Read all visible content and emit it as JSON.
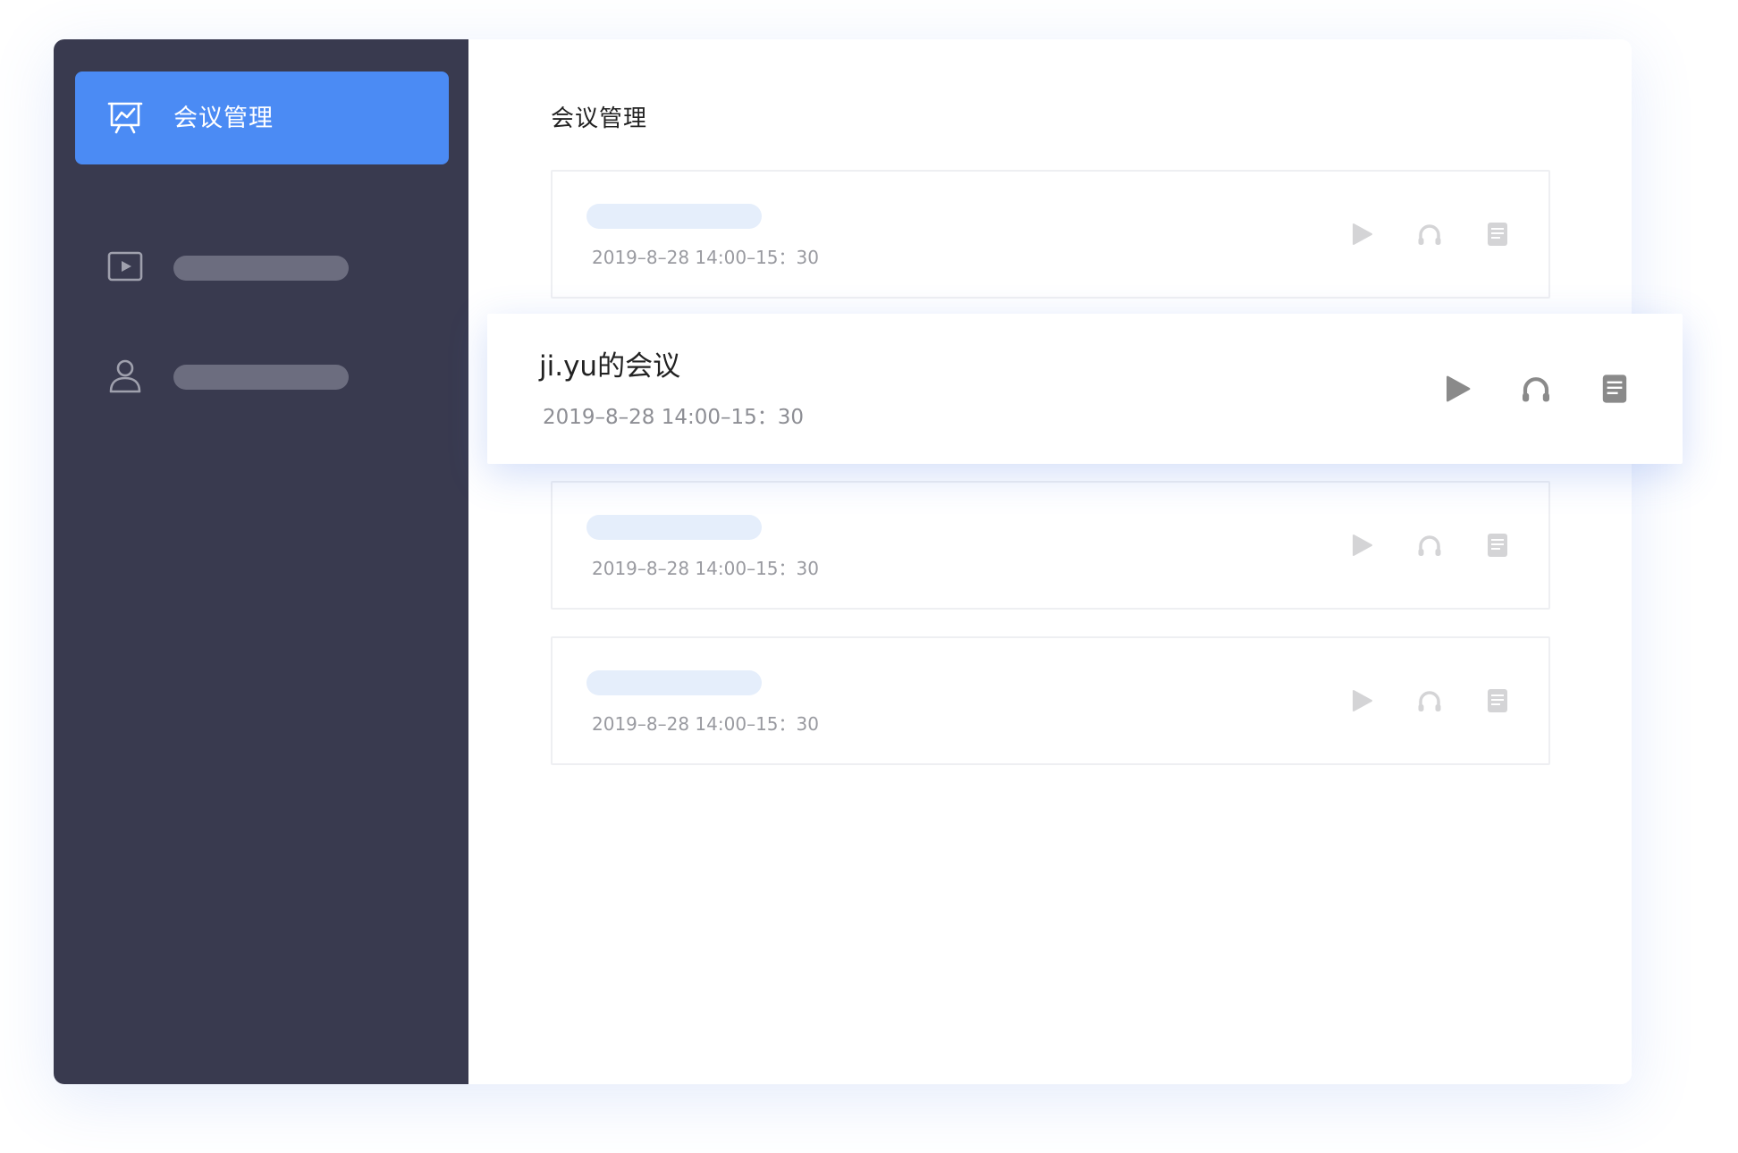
{
  "sidebar": {
    "items": [
      {
        "label": "会议管理",
        "icon": "presentation-chart-icon",
        "active": true
      },
      {
        "label": "",
        "icon": "video-play-icon",
        "active": false
      },
      {
        "label": "",
        "icon": "user-icon",
        "active": false
      }
    ]
  },
  "main": {
    "title": "会议管理",
    "meetings": [
      {
        "title": "",
        "time": "2019–8–28 14:00–15：30"
      },
      {
        "title": "",
        "time": "2019–8–28 14:00–15：30"
      },
      {
        "title": "",
        "time": "2019–8–28 14:00–15：30"
      }
    ],
    "featured": {
      "title": "ji.yu的会议",
      "time": "2019–8–28 14:00–15：30"
    },
    "actions": [
      "play-icon",
      "headphones-icon",
      "document-icon"
    ]
  },
  "colors": {
    "sidebar_bg": "#393a4f",
    "accent": "#4b8bf4",
    "placeholder_light": "#e5eefb",
    "placeholder_dark": "#6c6d7f",
    "icon_muted": "#d4d4d6",
    "icon_active": "#8a8a8a"
  }
}
